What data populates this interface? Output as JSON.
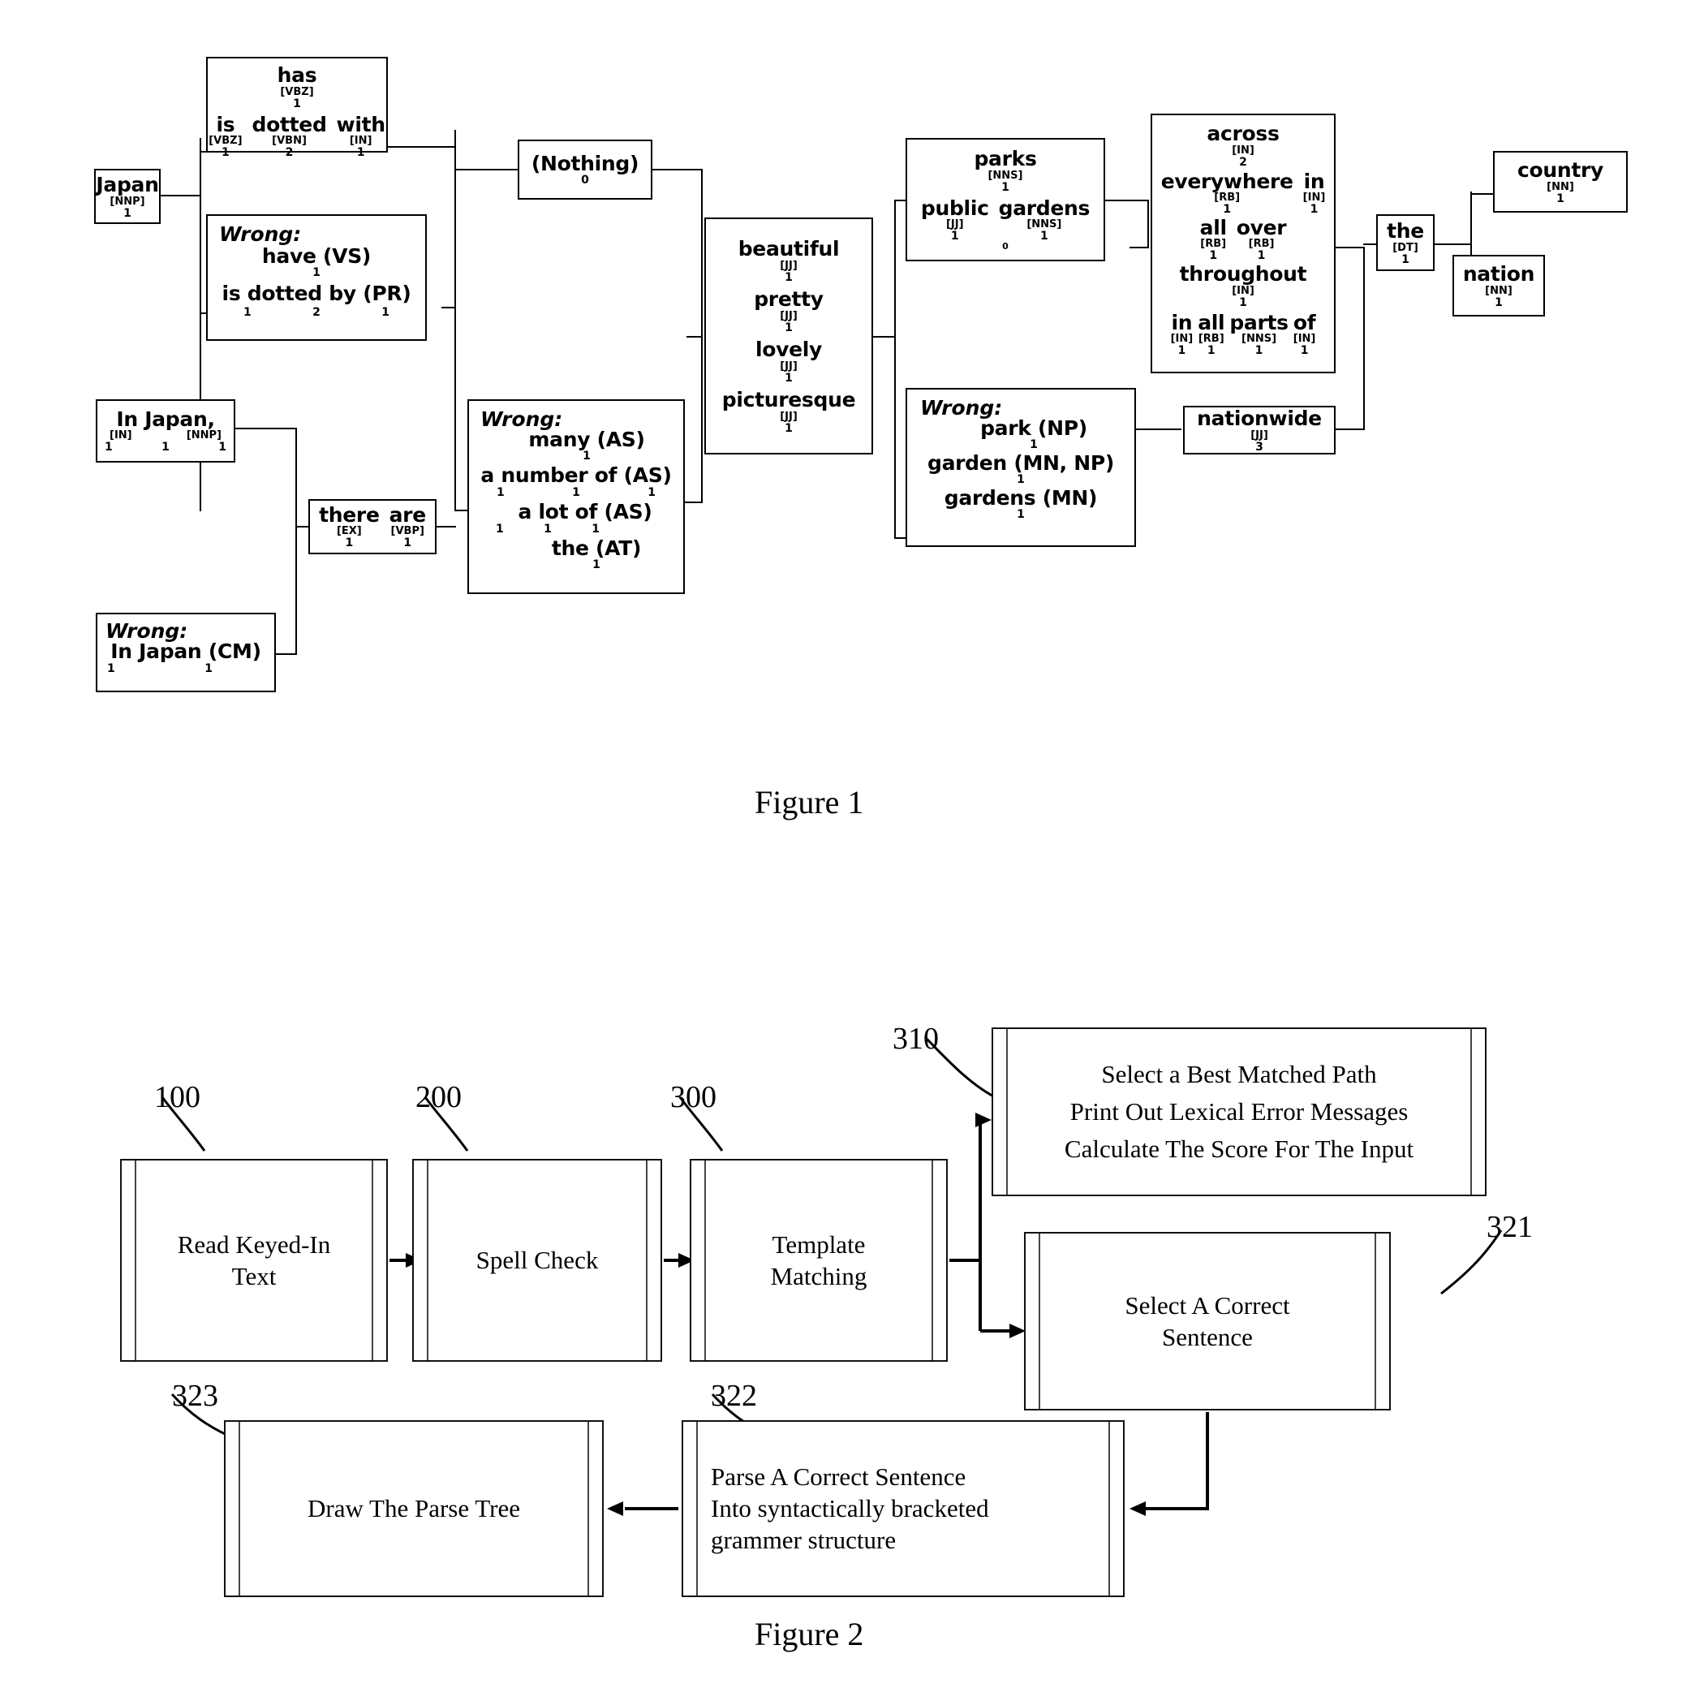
{
  "figure1": {
    "caption": "Figure 1",
    "nodes": {
      "japan": {
        "word": "Japan",
        "tag": "[NNP]",
        "count": "1"
      },
      "has_is_dotted_with": {
        "line1": {
          "word": "has",
          "tag": "[VBZ]",
          "count": "1"
        },
        "line2": [
          {
            "word": "is",
            "tag": "[VBZ]",
            "count": "1"
          },
          {
            "word": "dotted",
            "tag": "[VBN]",
            "count": "2"
          },
          {
            "word": "with",
            "tag": "[IN]",
            "count": "1"
          }
        ]
      },
      "wrong_have": {
        "label": "Wrong:",
        "line1": {
          "word": "have (VS)",
          "count": "1"
        },
        "line2": {
          "word": "is dotted by (PR)",
          "counts": [
            "1",
            "2",
            "1"
          ]
        }
      },
      "nothing": {
        "word": "(Nothing)",
        "count": "0"
      },
      "in_japan": {
        "word": "In Japan,",
        "tags": [
          "[IN]",
          "[NNP]"
        ],
        "counts": [
          "1",
          "1",
          "1"
        ]
      },
      "wrong_in_japan_cm": {
        "label": "Wrong:",
        "word": "In Japan (CM)",
        "counts": [
          "1",
          "1"
        ]
      },
      "there_are": {
        "tokens": [
          {
            "word": "there",
            "tag": "[EX]",
            "count": "1"
          },
          {
            "word": "are",
            "tag": "[VBP]",
            "count": "1"
          }
        ]
      },
      "wrong_many": {
        "label": "Wrong:",
        "line1": {
          "word": "many (AS)",
          "count": "1"
        },
        "line2": {
          "word": "a number of (AS)",
          "counts": [
            "1",
            "1",
            "1"
          ]
        },
        "line3": {
          "word": "a  lot  of (AS)",
          "counts": [
            "1",
            "1",
            "1"
          ]
        },
        "line4": {
          "word": "the (AT)",
          "count": "1"
        }
      },
      "adjectives": [
        {
          "word": "beautiful",
          "tag": "[JJ]",
          "count": "1"
        },
        {
          "word": "pretty",
          "tag": "[JJ]",
          "count": "1"
        },
        {
          "word": "lovely",
          "tag": "[JJ]",
          "count": "1"
        },
        {
          "word": "picturesque",
          "tag": "[JJ]",
          "count": "1"
        }
      ],
      "parks": {
        "line1": {
          "word": "parks",
          "tag": "[NNS]",
          "count": "1"
        },
        "line2": [
          {
            "word": "public",
            "tag": "[JJ]",
            "count": "1"
          },
          {
            "word": "gardens",
            "tag": "[NNS]",
            "count": "1"
          }
        ],
        "extra": "0"
      },
      "wrong_park": {
        "label": "Wrong:",
        "line1": {
          "word": "park (NP)",
          "count": "1"
        },
        "line2": {
          "word": "garden (MN, NP)",
          "count": "1"
        },
        "line3": {
          "word": "gardens (MN)",
          "count": "1"
        }
      },
      "across": {
        "line1": {
          "word": "across",
          "tag": "[IN]",
          "count": "2"
        },
        "line2": [
          {
            "word": "everywhere",
            "tag": "[RB]",
            "count": "1"
          },
          {
            "word": "in",
            "tag": "[IN]",
            "count": "1"
          }
        ],
        "line3": [
          {
            "word": "all",
            "tag": "[RB]",
            "count": "1"
          },
          {
            "word": "over",
            "tag": "[RB]",
            "count": "1"
          }
        ],
        "line4": {
          "word": "throughout",
          "tag": "[IN]",
          "count": "1"
        },
        "line5": [
          {
            "word": "in",
            "tag": "[IN]",
            "count": "1"
          },
          {
            "word": "all",
            "tag": "[RB]",
            "count": "1"
          },
          {
            "word": "parts",
            "tag": "[NNS]",
            "count": "1"
          },
          {
            "word": "of",
            "tag": "[IN]",
            "count": "1"
          }
        ]
      },
      "nationwide": {
        "word": "nationwide",
        "tag": "[JJ]",
        "count": "3"
      },
      "the": {
        "word": "the",
        "tag": "[DT]",
        "count": "1"
      },
      "country": {
        "word": "country",
        "tag": "[NN]",
        "count": "1"
      },
      "nation": {
        "word": "nation",
        "tag": "[NN]",
        "count": "1"
      }
    }
  },
  "figure2": {
    "caption": "Figure 2",
    "boxes": {
      "read": {
        "ref": "100",
        "lines": [
          "Read Keyed-In",
          "Text"
        ]
      },
      "spell": {
        "ref": "200",
        "lines": [
          "Spell Check"
        ]
      },
      "template": {
        "ref": "300",
        "lines": [
          "Template",
          "Matching"
        ]
      },
      "best_path": {
        "ref": "310",
        "lines": [
          "Select a Best Matched Path",
          "Print Out Lexical Error Messages",
          "Calculate The Score For The Input"
        ]
      },
      "select_sentence": {
        "ref": "321",
        "lines": [
          "Select A Correct",
          "Sentence"
        ]
      },
      "parse_sentence": {
        "ref": "322",
        "lines": [
          "Parse A Correct Sentence",
          "Into syntactically bracketed",
          "grammer structure"
        ]
      },
      "draw_tree": {
        "ref": "323",
        "lines": [
          "Draw The Parse Tree"
        ]
      }
    }
  }
}
